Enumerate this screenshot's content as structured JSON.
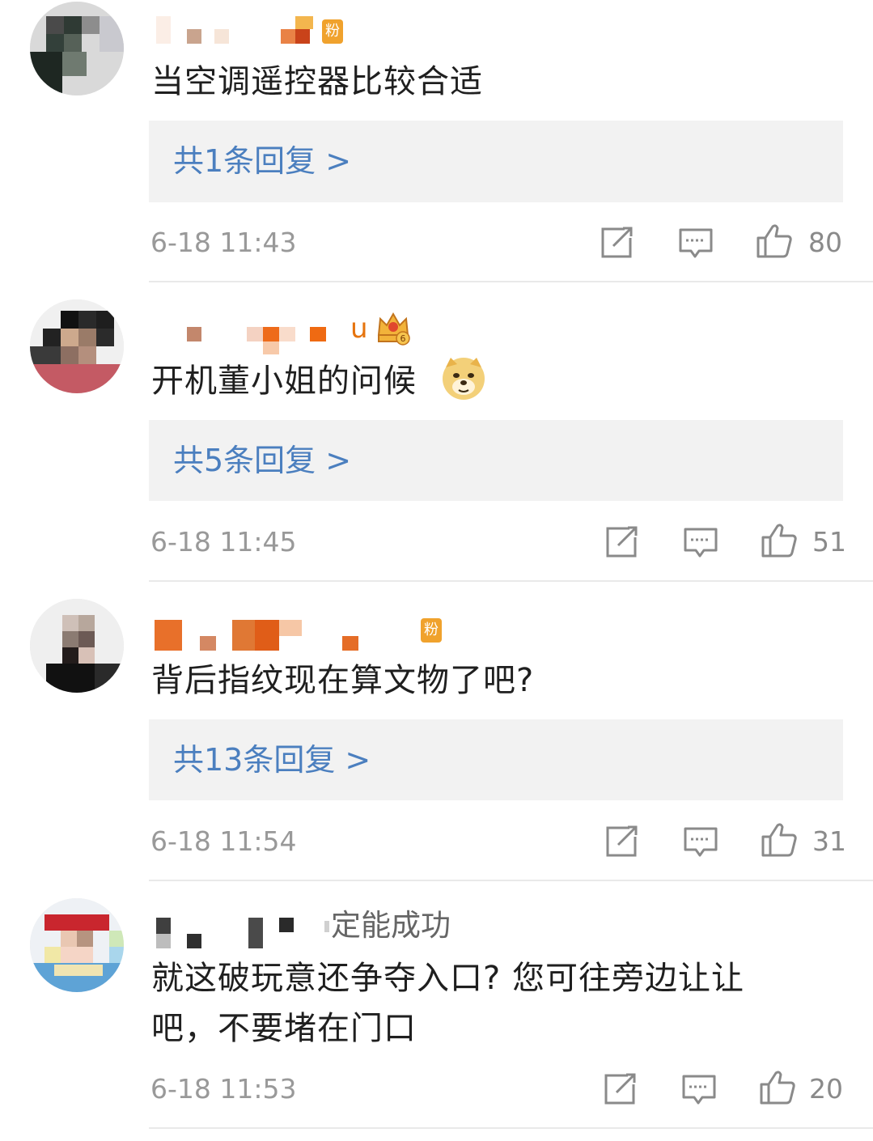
{
  "comments": [
    {
      "badge": "粉",
      "text": "当空调遥控器比较合适",
      "reply": "共1条回复 >",
      "time": "6-18 11:43",
      "likes": "80"
    },
    {
      "name_suffix": "u",
      "crown_badge_number": "6",
      "text": "开机董小姐的问候",
      "emoji": "doge",
      "reply": "共5条回复 >",
      "time": "6-18 11:45",
      "likes": "51"
    },
    {
      "badge": "粉",
      "text": "背后指纹现在算文物了吧?",
      "reply": "共13条回复 >",
      "time": "6-18 11:54",
      "likes": "31"
    },
    {
      "name_tail": "定能成功",
      "text": "就这破玩意还争夺入口? 您可往旁边让让吧，不要堵在门口",
      "time": "6-18 11:53",
      "likes": "20"
    }
  ],
  "icons": {
    "share": "share-icon",
    "comment": "comment-icon",
    "like": "thumbs-up-icon"
  },
  "colors": {
    "reply_link": "#4b7fbf",
    "meta": "#999999",
    "reply_bg": "#f2f2f2",
    "fan_badge": "#f0a22d"
  }
}
